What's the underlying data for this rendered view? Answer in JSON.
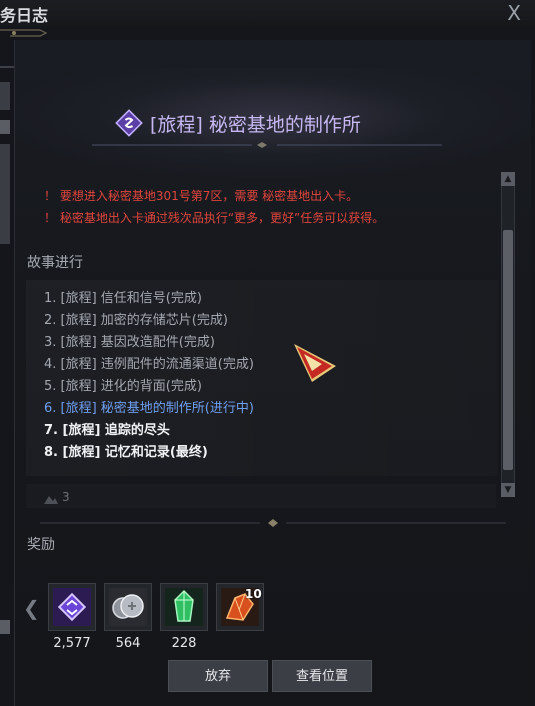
{
  "window": {
    "title": "务日志",
    "close_label": "X"
  },
  "quest": {
    "title": "[旅程] 秘密基地的制作所",
    "warnings": [
      "！ 要想进入秘密基地301号第7区，需要 秘密基地出入卡。",
      "！  秘密基地出入卡通过残次品执行“更多，更好”任务可以获得。"
    ]
  },
  "story": {
    "heading": "故事进行",
    "steps": [
      {
        "text": "1. [旅程] 信任和信号(完成)",
        "state": "done"
      },
      {
        "text": "2. [旅程] 加密的存储芯片(完成)",
        "state": "done"
      },
      {
        "text": "3. [旅程] 基因改造配件(完成)",
        "state": "done"
      },
      {
        "text": "4. [旅程] 违例配件的流通渠道(完成)",
        "state": "done"
      },
      {
        "text": "5. [旅程] 进化的背面(完成)",
        "state": "done"
      },
      {
        "text": "6. [旅程] 秘密基地的制作所(进行中)",
        "state": "current"
      },
      {
        "text": "7. [旅程] 追踪的尽头",
        "state": "todo"
      },
      {
        "text": "8. [旅程] 记忆和记录(最终)",
        "state": "todo"
      }
    ],
    "partial_row_text": "3"
  },
  "rewards": {
    "heading": "奖励",
    "items": [
      {
        "icon": "purple-emblem-icon",
        "count": "2,577"
      },
      {
        "icon": "silver-coins-icon",
        "count": "564"
      },
      {
        "icon": "green-crystal-icon",
        "count": "228"
      },
      {
        "icon": "orange-shard-icon",
        "badge": "10"
      }
    ]
  },
  "buttons": {
    "abandon": "放弃",
    "view_location": "查看位置"
  },
  "colors": {
    "quest_title": "#c7b7f2",
    "warning": "#e0453c",
    "current_step": "#6f9ff0",
    "done_step": "#a4a8b0"
  }
}
